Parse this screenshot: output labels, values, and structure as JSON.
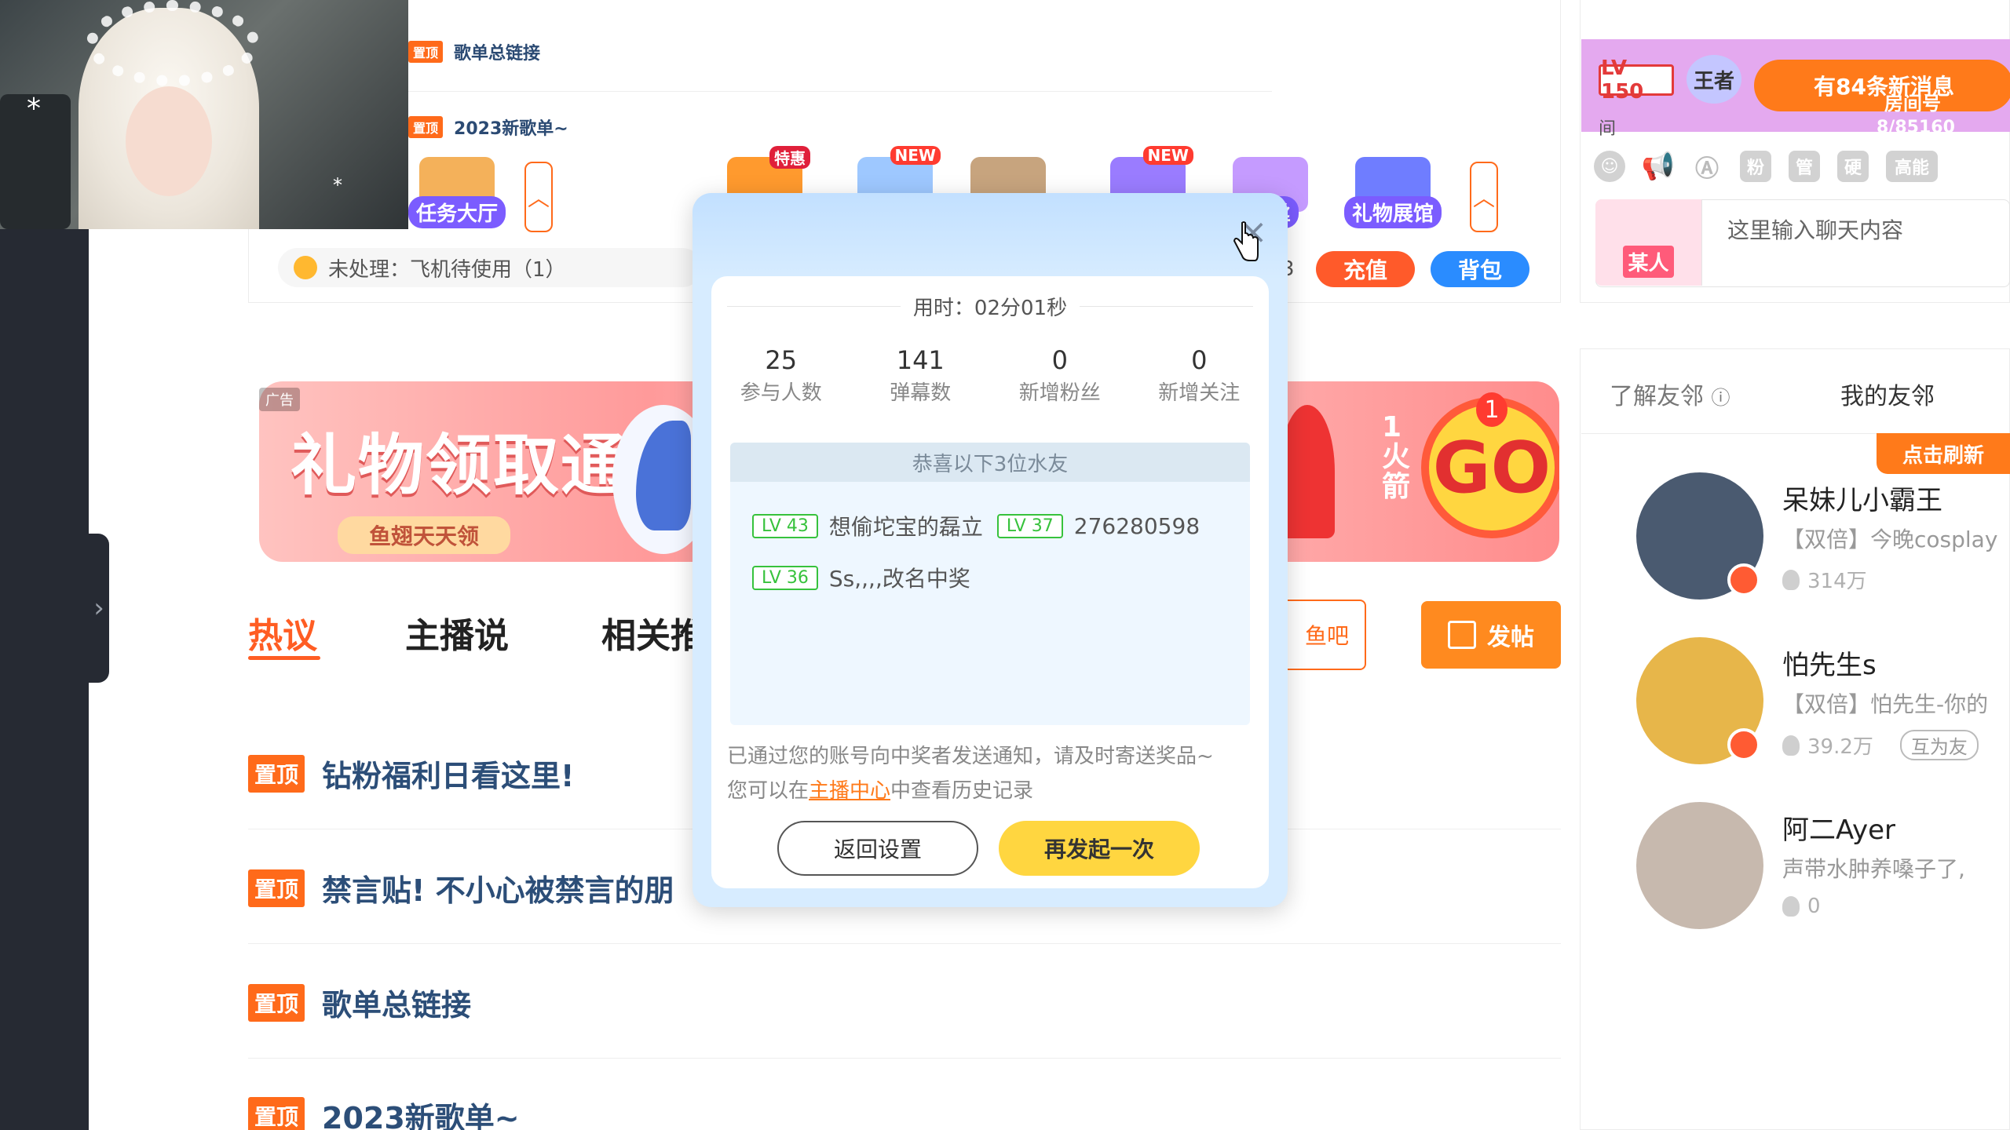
{
  "top_card": {
    "list_items": [
      {
        "tag": "置顶",
        "title": "歌单总链接"
      },
      {
        "tag": "置顶",
        "title": "2023新歌单~"
      }
    ],
    "gift_row": [
      {
        "label": "任务大厅",
        "badge": ""
      },
      {
        "label": "",
        "badge": "特惠"
      },
      {
        "label": "",
        "badge": "NEW"
      },
      {
        "label": "",
        "badge": ""
      },
      {
        "label": "",
        "badge": "NEW"
      },
      {
        "label": "粉丝",
        "badge": ""
      },
      {
        "label": "礼物展馆",
        "badge": ""
      }
    ],
    "pending_text": "未处理：飞机待使用（1）",
    "partial_number": "3",
    "recharge_label": "充值",
    "bag_label": "背包",
    "arrow_icon": "chevron-up-icon"
  },
  "ad": {
    "tag": "广告",
    "title": "礼物领取通知",
    "subtitle": "鱼翅天天领",
    "rocket_text": "1火箭",
    "go_text": "GO",
    "badge": "1"
  },
  "tabs": [
    {
      "label": "热议",
      "active": true
    },
    {
      "label": "主播说",
      "active": false
    },
    {
      "label": "相关推",
      "active": false
    }
  ],
  "yuba_label": "鱼吧",
  "post_label": "发帖",
  "posts": [
    {
      "tag": "置顶",
      "title": "钻粉福利日看这里!"
    },
    {
      "tag": "置顶",
      "title": "禁言贴! 不小心被禁言的朋"
    },
    {
      "tag": "置顶",
      "title": "歌单总链接"
    },
    {
      "tag": "置顶",
      "title": "2023新歌单~"
    }
  ],
  "right_top": {
    "lv": "LV 150",
    "king": "王者",
    "notice": "有84条新消息",
    "notice_sub": "房间号",
    "notice_num": "8/85160",
    "jian": "间",
    "chat_icons": [
      "smile-icon",
      "megaphone-icon",
      "font-icon",
      "粉",
      "管",
      "硬",
      "高能"
    ],
    "chat_avatar_text": "某人",
    "chat_placeholder": "这里输入聊天内容"
  },
  "friends": {
    "tab_learn": "了解友邻",
    "tab_mine": "我的友邻",
    "refresh": "点击刷新",
    "items": [
      {
        "name": "呆妹儿小霸王",
        "desc": "【双倍】今晚cosplay",
        "heat": "314万",
        "mutual": ""
      },
      {
        "name": "怕先生s",
        "desc": "【双倍】怕先生-你的",
        "heat": "39.2万",
        "mutual": "互为友"
      },
      {
        "name": "阿二Ayer",
        "desc": "声带水肿养嗓子了,",
        "heat": "0",
        "mutual": ""
      }
    ]
  },
  "modal": {
    "duration": "用时：02分01秒",
    "stats": [
      {
        "value": "25",
        "label": "参与人数"
      },
      {
        "value": "141",
        "label": "弹幕数"
      },
      {
        "value": "0",
        "label": "新增粉丝"
      },
      {
        "value": "0",
        "label": "新增关注"
      }
    ],
    "winners_title": "恭喜以下3位水友",
    "winners": [
      {
        "lv": "LV 43",
        "name": "想偷坨宝的磊立"
      },
      {
        "lv": "LV 37",
        "name": "276280598"
      },
      {
        "lv": "LV 36",
        "name": "Ss,,,,改名中奖"
      }
    ],
    "note_line1": "已通过您的账号向中奖者发送通知，请及时寄送奖品~",
    "note_line2_pre": "您可以在",
    "note_link": "主播中心",
    "note_line2_post": "中查看历史记录",
    "back_label": "返回设置",
    "again_label": "再发起一次"
  }
}
